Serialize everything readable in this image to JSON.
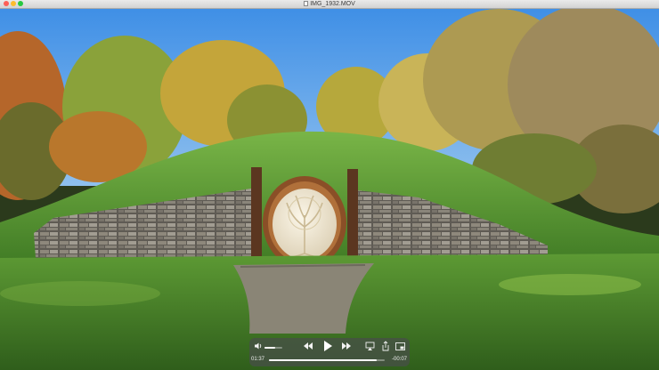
{
  "window": {
    "title": "IMG_1932.MOV"
  },
  "icons": {
    "close": "close-button",
    "minimize": "minimize-button",
    "zoom": "zoom-button",
    "file": "movie-file-icon",
    "volume": "speaker-icon",
    "rewind": "rewind-icon",
    "play": "play-icon",
    "fast_forward": "fast-forward-icon",
    "airplay": "airplay-icon",
    "share": "share-icon",
    "pip": "picture-in-picture-icon"
  },
  "video": {
    "subject": "hobbit-hole",
    "door_emblem": "tree-of-life"
  },
  "player": {
    "elapsed": "01:37",
    "remaining": "-00:07",
    "progress": 0.93,
    "volume": 0.6
  },
  "colors": {
    "sky": "#4f9be8",
    "grass": "#4d8a2c",
    "door_frame": "#9a5a2c",
    "door_panel": "#efe7d2",
    "stone": "#7f7a70"
  }
}
